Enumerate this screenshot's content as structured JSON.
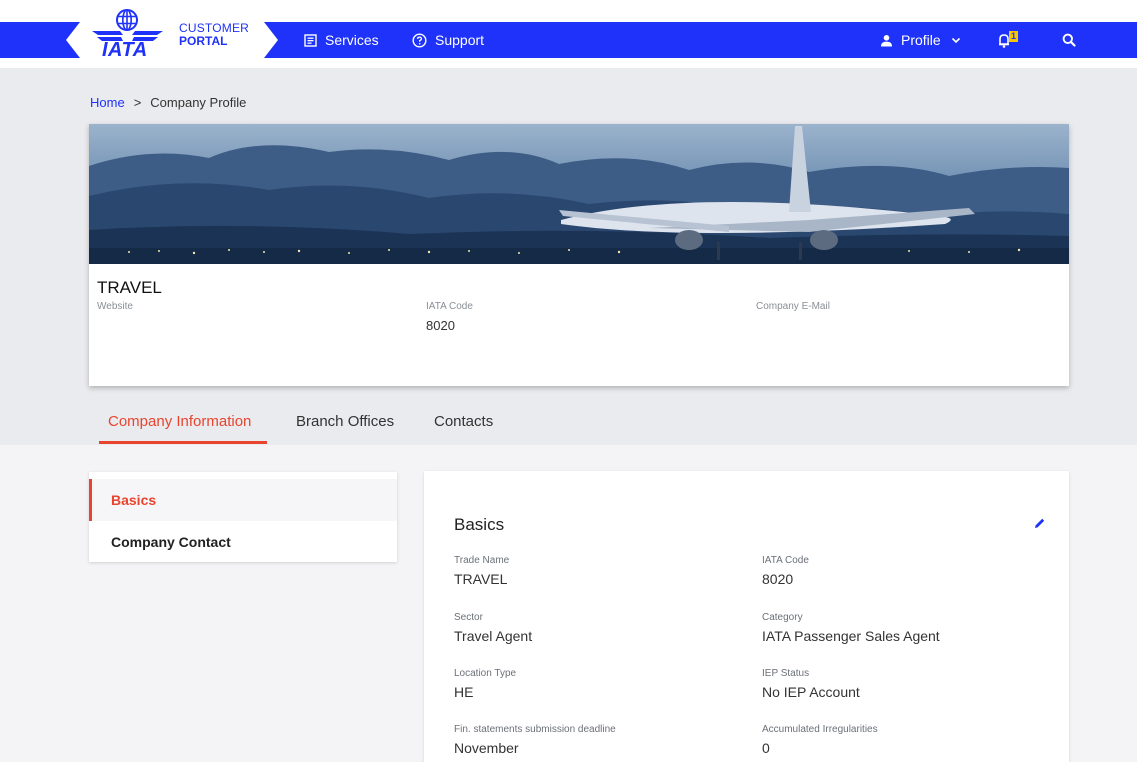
{
  "header": {
    "logo": {
      "iata": "IATA",
      "customer": "CUSTOMER",
      "portal": "PORTAL"
    },
    "nav": [
      {
        "label": "Services",
        "icon": "services-icon"
      },
      {
        "label": "Support",
        "icon": "help-circle-icon"
      }
    ],
    "profile_label": "Profile",
    "notifications_count": "1",
    "colors": {
      "brand": "#1e32fa",
      "accent": "#e8442e"
    }
  },
  "breadcrumb": {
    "home": "Home",
    "separator": ">",
    "current": "Company Profile"
  },
  "company": {
    "name": "TRAVEL",
    "website_label": "Website",
    "website_value": "",
    "iata_code_label": "IATA Code",
    "iata_code_value": "8020",
    "email_label": "Company E-Mail",
    "email_value": ""
  },
  "tabs": [
    {
      "label": "Company Information",
      "active": true
    },
    {
      "label": "Branch Offices",
      "active": false
    },
    {
      "label": "Contacts",
      "active": false
    }
  ],
  "sidemenu": [
    {
      "label": "Basics",
      "active": true
    },
    {
      "label": "Company Contact",
      "active": false
    }
  ],
  "basics": {
    "title": "Basics",
    "fields": [
      {
        "label": "Trade Name",
        "value": "TRAVEL"
      },
      {
        "label": "IATA Code",
        "value": "8020"
      },
      {
        "label": "Sector",
        "value": "Travel Agent"
      },
      {
        "label": "Category",
        "value": "IATA Passenger Sales Agent"
      },
      {
        "label": "Location Type",
        "value": "HE"
      },
      {
        "label": "IEP Status",
        "value": "No IEP Account"
      },
      {
        "label": "Fin. statements submission deadline",
        "value": "November"
      },
      {
        "label": "Accumulated Irregularities",
        "value": "0"
      }
    ]
  }
}
